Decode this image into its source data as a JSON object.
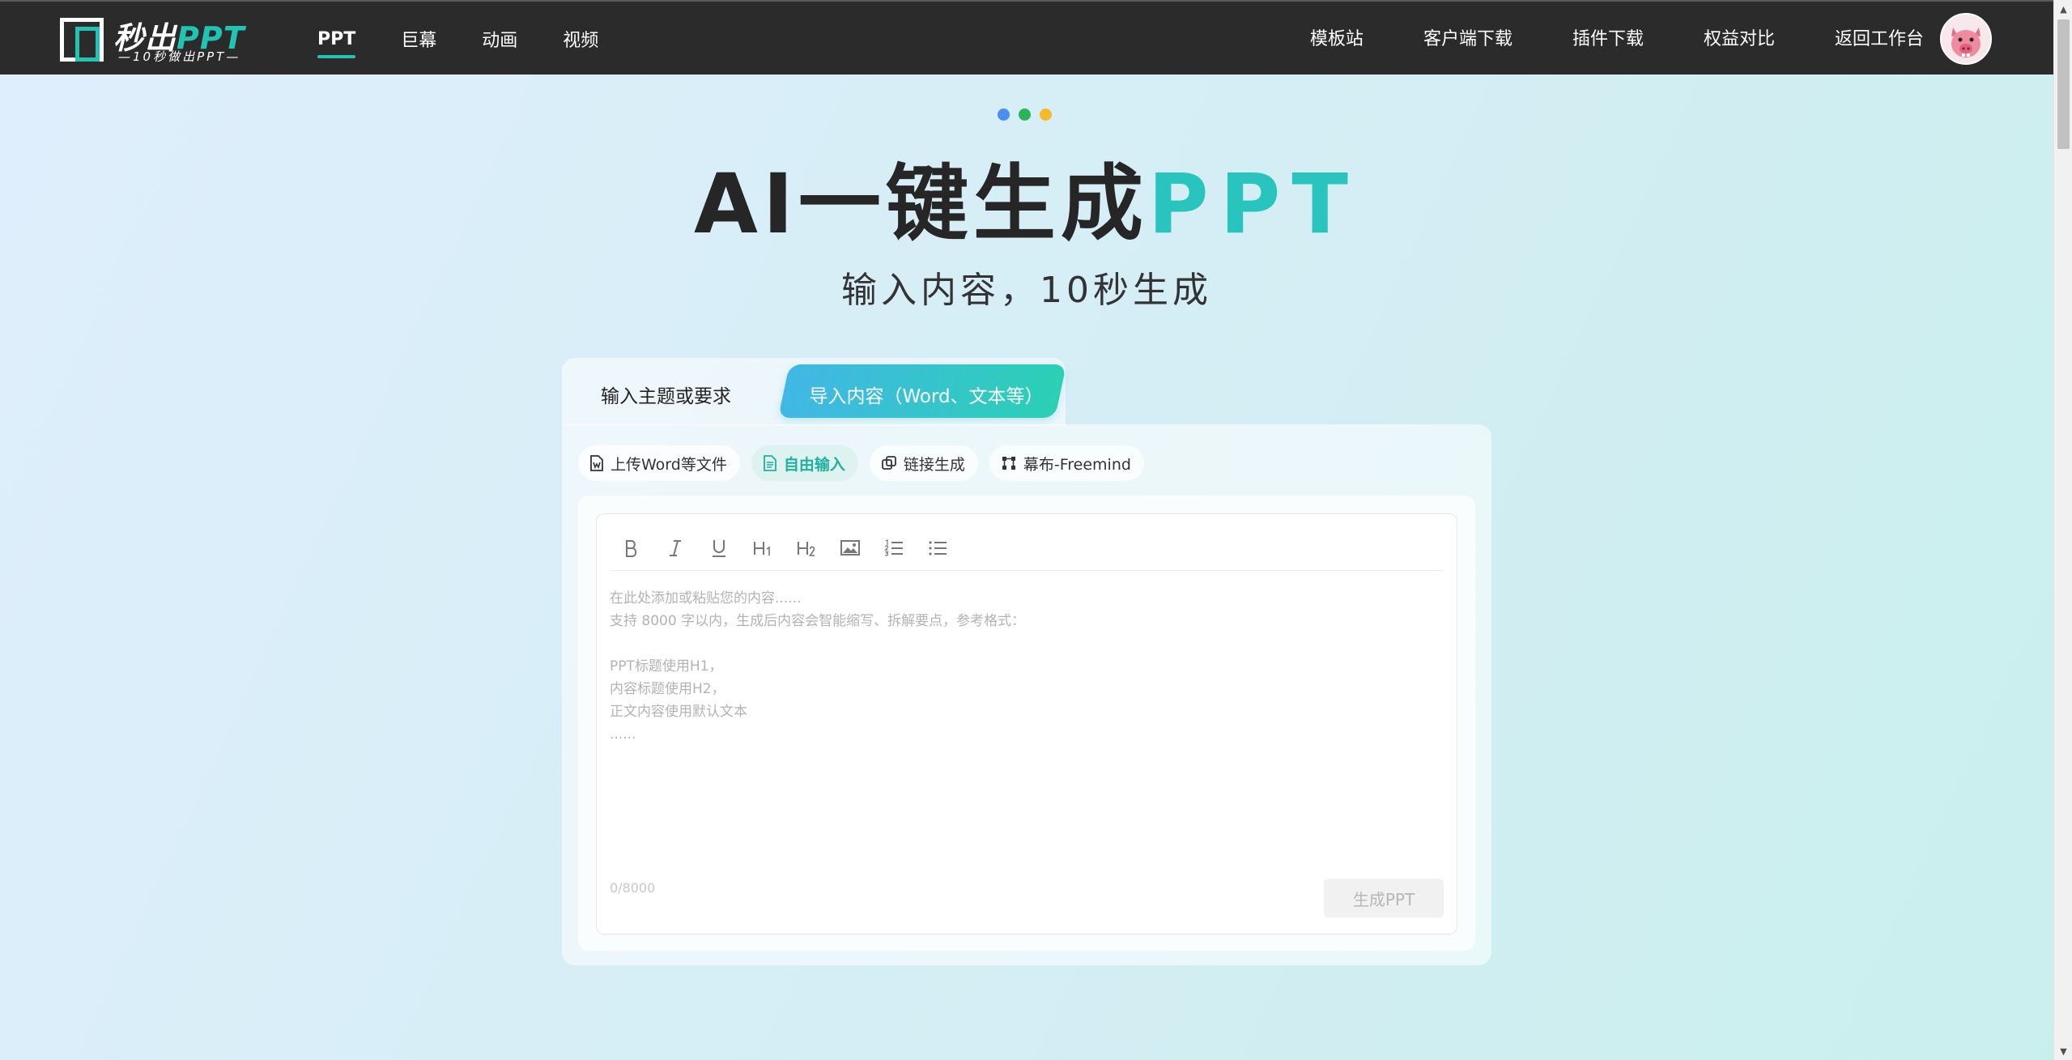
{
  "brand": {
    "name_prefix": "秒出",
    "name_accent": "PPT",
    "tagline": "—10秒做出PPT—",
    "accent_color": "#22c3b2"
  },
  "nav_left": [
    {
      "label": "PPT",
      "active": true
    },
    {
      "label": "巨幕",
      "active": false
    },
    {
      "label": "动画",
      "active": false
    },
    {
      "label": "视频",
      "active": false
    }
  ],
  "nav_right": [
    {
      "label": "模板站"
    },
    {
      "label": "客户端下载"
    },
    {
      "label": "插件下载"
    },
    {
      "label": "权益对比"
    },
    {
      "label": "返回工作台"
    }
  ],
  "dots_colors": [
    "#4a8ff2",
    "#2fb35a",
    "#f5b92a"
  ],
  "hero": {
    "title_main": "AI一键生成",
    "title_accent": "PPT",
    "subtitle": "输入内容，10秒生成"
  },
  "tabs": {
    "inactive": "输入主题或要求",
    "active": "导入内容（Word、文本等）"
  },
  "subtabs": [
    {
      "label": "上传Word等文件",
      "icon": "word-file-icon",
      "active": false
    },
    {
      "label": "自由输入",
      "icon": "document-icon",
      "active": true
    },
    {
      "label": "链接生成",
      "icon": "link-icon",
      "active": false
    },
    {
      "label": "幕布-Freemind",
      "icon": "mindmap-icon",
      "active": false
    }
  ],
  "editor": {
    "toolbar": [
      "bold-icon",
      "italic-icon",
      "underline-icon",
      "heading1-icon",
      "heading2-icon",
      "image-icon",
      "ordered-list-icon",
      "bullet-list-icon"
    ],
    "placeholder_lines": [
      "在此处添加或粘贴您的内容......",
      "支持 8000 字以内，生成后内容会智能缩写、拆解要点，参考格式：",
      "",
      "PPT标题使用H1，",
      "内容标题使用H2，",
      "正文内容使用默认文本",
      "......"
    ],
    "counter": "0/8000",
    "generate_label": "生成PPT"
  }
}
